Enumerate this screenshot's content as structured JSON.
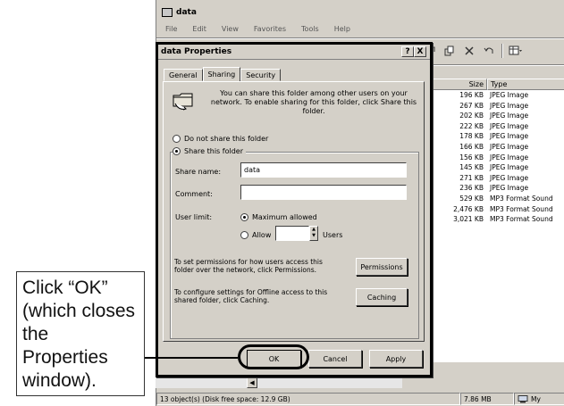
{
  "explorer": {
    "title": "data",
    "menu": [
      "File",
      "Edit",
      "View",
      "Favorites",
      "Tools",
      "Help"
    ],
    "toolbar_icons": [
      "move-to-icon",
      "copy-to-icon",
      "delete-icon",
      "undo-icon",
      "views-icon"
    ],
    "columns": {
      "size": "Size",
      "type": "Type"
    },
    "rows": [
      {
        "size": "196 KB",
        "type": "JPEG Image"
      },
      {
        "size": "267 KB",
        "type": "JPEG Image"
      },
      {
        "size": "202 KB",
        "type": "JPEG Image"
      },
      {
        "size": "222 KB",
        "type": "JPEG Image"
      },
      {
        "size": "178 KB",
        "type": "JPEG Image"
      },
      {
        "size": "166 KB",
        "type": "JPEG Image"
      },
      {
        "size": "156 KB",
        "type": "JPEG Image"
      },
      {
        "size": "145 KB",
        "type": "JPEG Image"
      },
      {
        "size": "271 KB",
        "type": "JPEG Image"
      },
      {
        "size": "236 KB",
        "type": "JPEG Image"
      },
      {
        "size": "529 KB",
        "type": "MP3 Format Sound"
      },
      {
        "size": "2,476 KB",
        "type": "MP3 Format Sound"
      },
      {
        "size": "3,021 KB",
        "type": "MP3 Format Sound"
      }
    ],
    "status": {
      "objects": "13 object(s) (Disk free space: 12.9 GB)",
      "size": "7.86 MB",
      "location": "My"
    }
  },
  "dialog": {
    "title": "data Properties",
    "help_button": "?",
    "close_button": "X",
    "tabs": [
      "General",
      "Sharing",
      "Security"
    ],
    "active_tab": "Sharing",
    "info": "You can share this folder among other users on your network.  To enable sharing for this folder, click Share this folder.",
    "do_not_share": "Do not share this folder",
    "share_this": "Share this folder",
    "share_name_label": "Share name:",
    "share_name_value": "data",
    "comment_label": "Comment:",
    "comment_value": "",
    "user_limit_label": "User limit:",
    "max_allowed": "Maximum allowed",
    "allow": "Allow",
    "users": "Users",
    "permissions_text": "To set permissions for how users access this folder over the network, click Permissions.",
    "permissions_button": "Permissions",
    "caching_text": "To configure settings for Offline access to this shared folder, click Caching.",
    "caching_button": "Caching",
    "ok": "OK",
    "cancel": "Cancel",
    "apply": "Apply"
  },
  "callout": {
    "text": "Click “OK” (which closes the Properties window)."
  }
}
